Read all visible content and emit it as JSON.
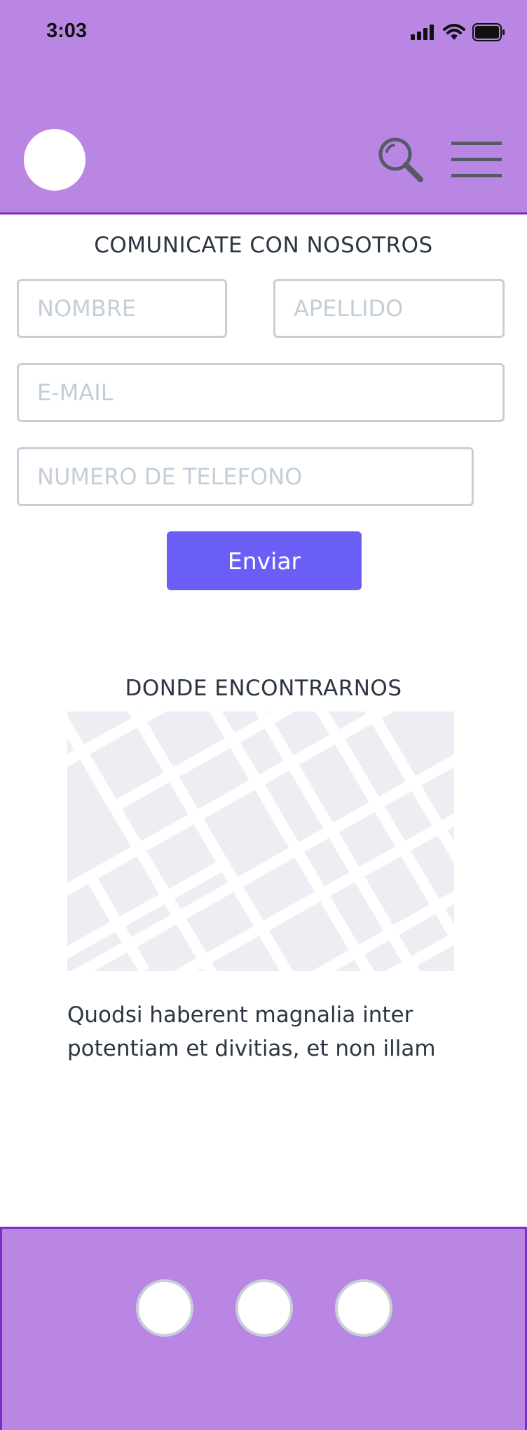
{
  "status_bar": {
    "time": "3:03"
  },
  "header": {
    "avatar_icon": "avatar-circle",
    "search_icon": "search-icon",
    "menu_icon": "hamburger-menu-icon"
  },
  "contact": {
    "title": "COMUNICATE CON NOSOTROS",
    "first_name_placeholder": "NOMBRE",
    "last_name_placeholder": "APELLIDO",
    "email_placeholder": "E-MAIL",
    "phone_placeholder": "NUMERO DE TELEFONO",
    "submit_label": "Enviar"
  },
  "location": {
    "title": "DONDE ENCONTRARNOS",
    "description": "Quodsi haberent magnalia inter potentiam et divitias, et non illam"
  },
  "footer": {
    "links": [
      "social-link-1",
      "social-link-2",
      "social-link-3"
    ]
  },
  "colors": {
    "header_bg": "#b987e3",
    "header_border": "#7c2fc7",
    "button": "#6b5ef7",
    "text": "#2b3642"
  }
}
